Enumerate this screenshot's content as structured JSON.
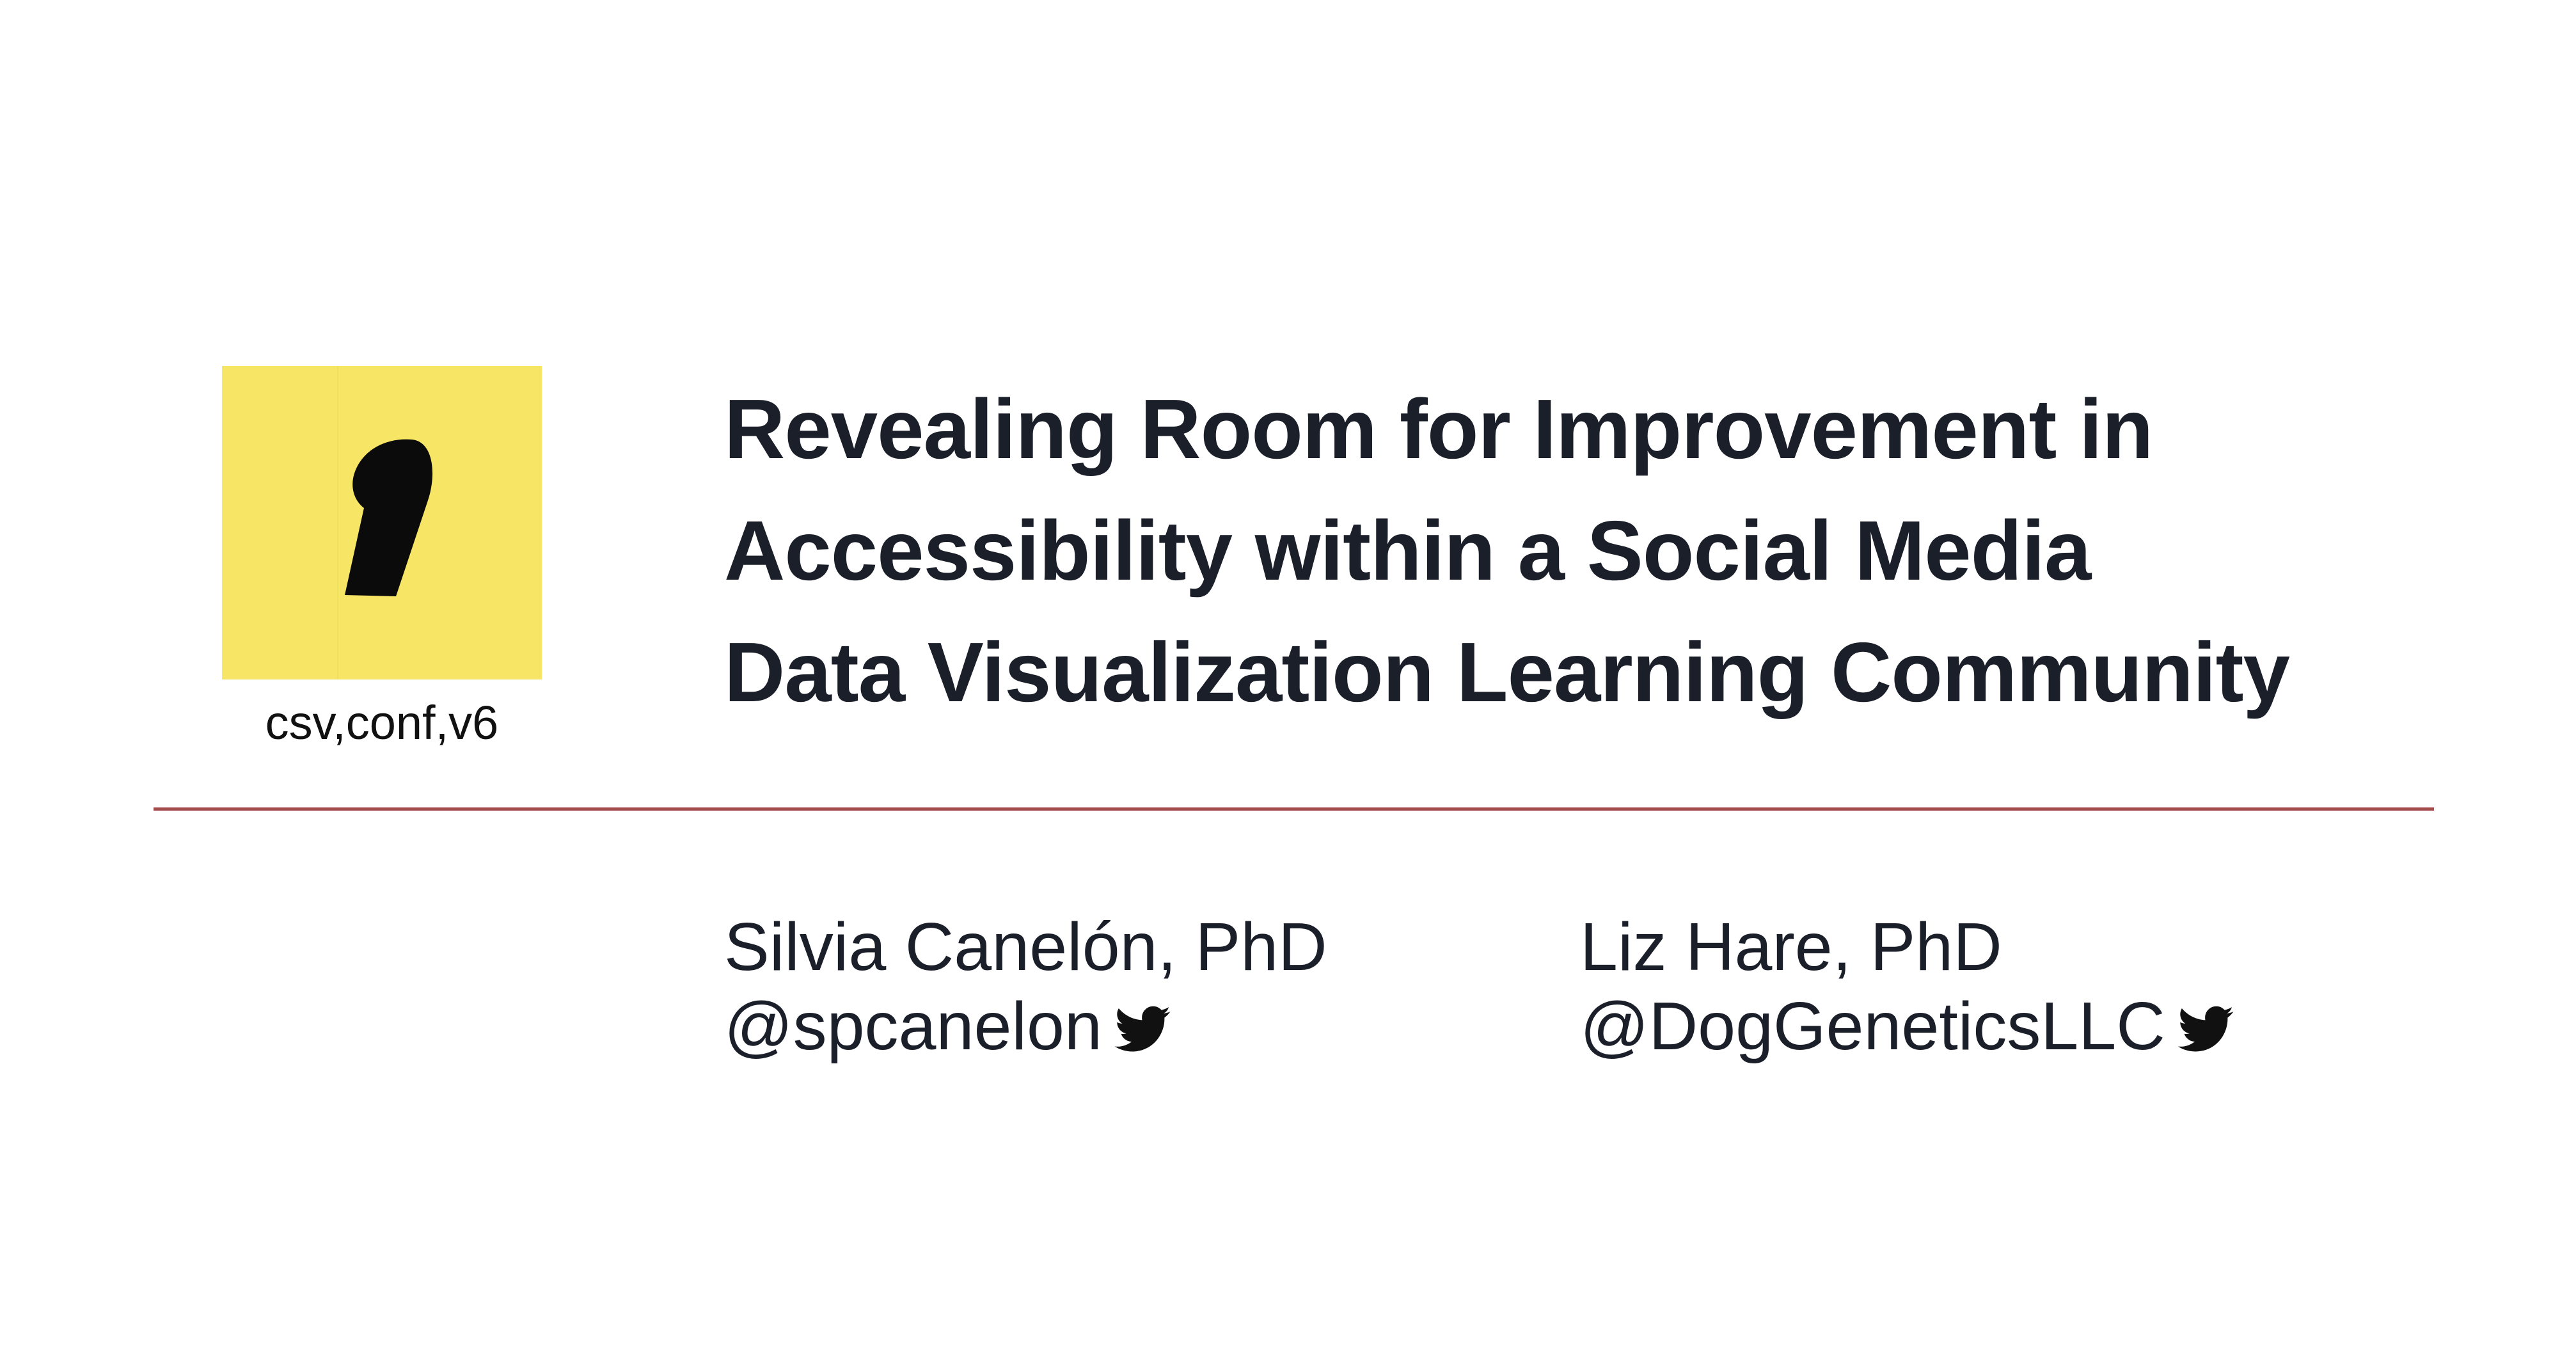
{
  "logo": {
    "icon": "comma-icon",
    "background_color": "#f7e565",
    "caption": "csv,conf,v6"
  },
  "title": {
    "lines": [
      "Revealing Room for Improvement in",
      "Accessibility within a Social Media",
      "Data Visualization Learning Community"
    ]
  },
  "divider": {
    "color": "#a64b4b"
  },
  "authors": [
    {
      "name": "Silvia Canelón, PhD",
      "handle": "@spcanelon",
      "icon": "twitter-bird-icon"
    },
    {
      "name": "Liz Hare, PhD",
      "handle": "@DogGeneticsLLC",
      "icon": "twitter-bird-icon"
    }
  ]
}
